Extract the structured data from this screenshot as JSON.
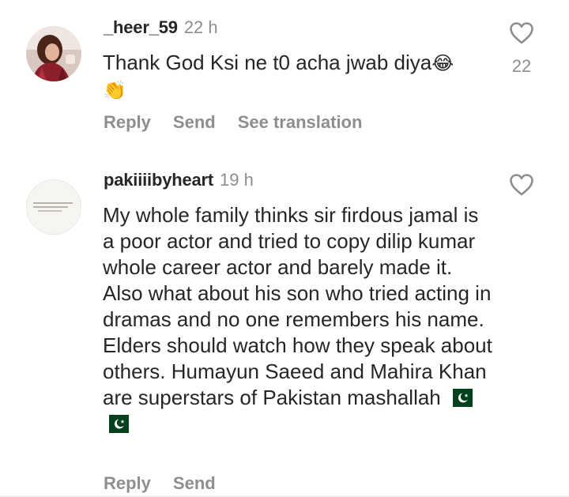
{
  "comments": [
    {
      "username": "_heer_59",
      "time": "22 h",
      "text": "Thank God Ksi ne t0 acha jwab diya",
      "emoji_1": "😂",
      "emoji_2": "👏",
      "likes": "22",
      "actions": {
        "reply": "Reply",
        "send": "Send",
        "translate": "See translation"
      }
    },
    {
      "username": "pakiiiibyheart",
      "time": "19 h",
      "text": "My whole family thinks sir firdous jamal is a poor actor and tried to copy dilip kumar whole career actor and barely made it. Also what about his son who tried acting in dramas and no one remembers his name. Elders should watch how they speak about others. Humayun Saeed and Mahira Khan are superstars of Pakistan mashallah",
      "actions": {
        "reply": "Reply",
        "send": "Send"
      }
    }
  ],
  "colors": {
    "text": "#262626",
    "muted": "#8e8e8e",
    "flag_green": "#01411c"
  }
}
